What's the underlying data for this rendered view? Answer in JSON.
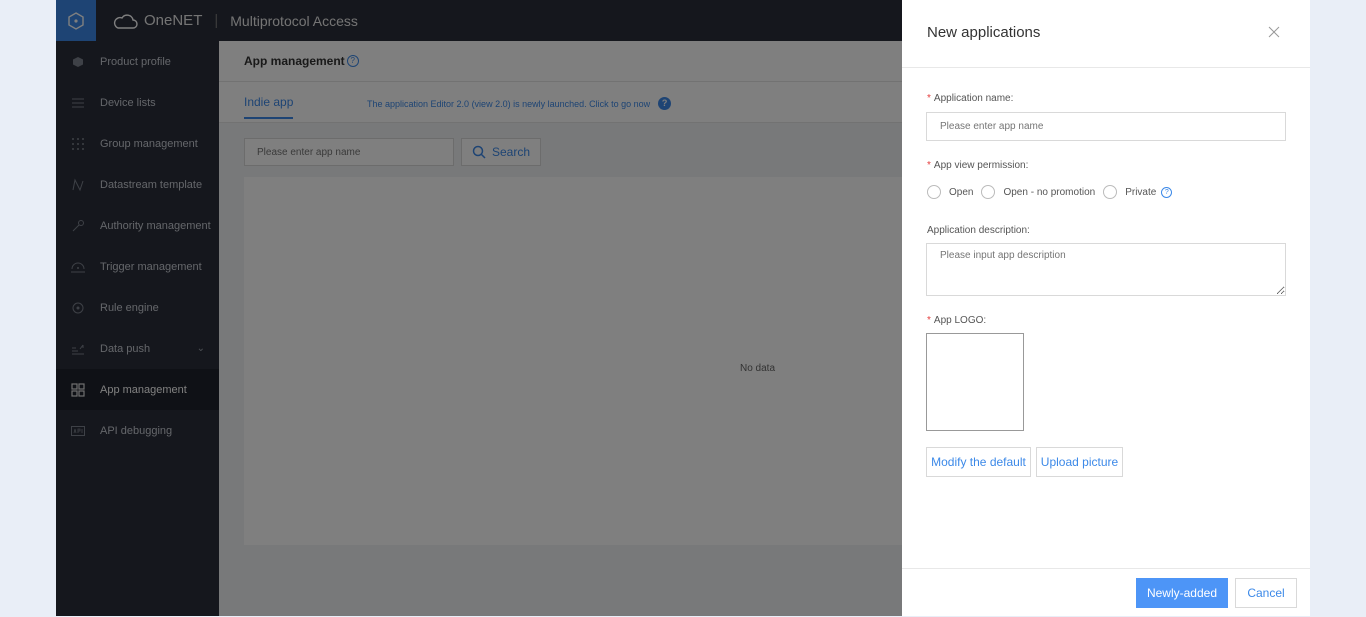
{
  "topbar": {
    "brand": "OneNET",
    "subtitle": "Multiprotocol Access"
  },
  "sidebar": {
    "items": [
      {
        "label": "Product profile",
        "icon": "cube-icon"
      },
      {
        "label": "Device lists",
        "icon": "list-icon"
      },
      {
        "label": "Group management",
        "icon": "grid-dots-icon"
      },
      {
        "label": "Datastream template",
        "icon": "datastream-icon"
      },
      {
        "label": "Authority management",
        "icon": "key-icon"
      },
      {
        "label": "Trigger management",
        "icon": "trigger-icon"
      },
      {
        "label": "Rule engine",
        "icon": "rule-icon"
      },
      {
        "label": "Data push",
        "icon": "data-push-icon"
      },
      {
        "label": "App management",
        "icon": "app-grid-icon"
      },
      {
        "label": "API debugging",
        "icon": "api-icon"
      }
    ],
    "active": "App management"
  },
  "main": {
    "page_title": "App management",
    "tab_label": "Indie app",
    "tab_note": "The application Editor 2.0 (view 2.0) is newly launched. Click to go now",
    "search_placeholder": "Please enter app name",
    "search_button": "Search",
    "empty_text": "No data"
  },
  "drawer": {
    "title": "New applications",
    "app_name_label": "Application name:",
    "app_name_placeholder": "Please enter app name",
    "permission_label": "App view permission:",
    "permission_options": [
      "Open",
      "Open - no promotion",
      "Private"
    ],
    "description_label": "Application description:",
    "description_placeholder": "Please input app description",
    "logo_label": "App LOGO:",
    "modify_default_button": "Modify the default",
    "upload_picture_button": "Upload picture",
    "submit_button": "Newly-added",
    "cancel_button": "Cancel"
  },
  "colors": {
    "accent": "#3c89e8",
    "sidebar_bg": "#2b2f3a",
    "primary_button": "#4d95f7",
    "required": "#e53e3e"
  }
}
